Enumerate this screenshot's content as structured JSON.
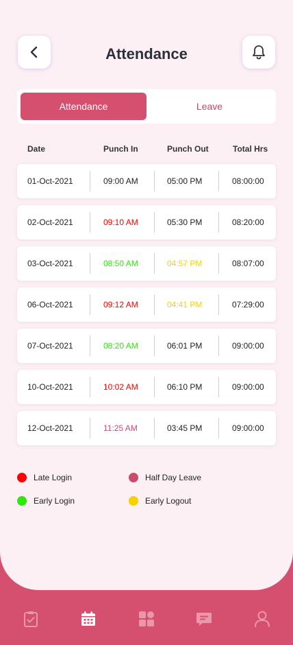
{
  "header": {
    "title": "Attendance"
  },
  "tabs": [
    {
      "label": "Attendance",
      "active": true
    },
    {
      "label": "Leave",
      "active": false
    }
  ],
  "table": {
    "columns": [
      "Date",
      "Punch In",
      "Punch Out",
      "Total Hrs"
    ],
    "rows": [
      {
        "date": "01-Oct-2021",
        "punch_in": "09:00 AM",
        "punch_in_status": "normal",
        "punch_out": "05:00 PM",
        "punch_out_status": "normal",
        "total": "08:00:00"
      },
      {
        "date": "02-Oct-2021",
        "punch_in": "09:10 AM",
        "punch_in_status": "late_login",
        "punch_out": "05:30 PM",
        "punch_out_status": "normal",
        "total": "08:20:00"
      },
      {
        "date": "03-Oct-2021",
        "punch_in": "08:50 AM",
        "punch_in_status": "early_login",
        "punch_out": "04:57 PM",
        "punch_out_status": "early_logout",
        "total": "08:07:00"
      },
      {
        "date": "06-Oct-2021",
        "punch_in": "09:12 AM",
        "punch_in_status": "late_login",
        "punch_out": "04:41 PM",
        "punch_out_status": "early_logout",
        "total": "07:29:00"
      },
      {
        "date": "07-Oct-2021",
        "punch_in": "08:20 AM",
        "punch_in_status": "early_login",
        "punch_out": "06:01 PM",
        "punch_out_status": "normal",
        "total": "09:00:00"
      },
      {
        "date": "10-Oct-2021",
        "punch_in": "10:02 AM",
        "punch_in_status": "late_login",
        "punch_out": "06:10 PM",
        "punch_out_status": "normal",
        "total": "09:00:00"
      },
      {
        "date": "12-Oct-2021",
        "punch_in": "11:25 AM",
        "punch_in_status": "half_day_leave",
        "punch_out": "03:45 PM",
        "punch_out_status": "normal",
        "total": "09:00:00"
      }
    ]
  },
  "legend": [
    {
      "key": "late_login",
      "label": "Late Login",
      "color": "#ff0000"
    },
    {
      "key": "half_day_leave",
      "label": "Half Day Leave",
      "color": "#cc4c6c"
    },
    {
      "key": "early_login",
      "label": "Early Login",
      "color": "#2ee80c"
    },
    {
      "key": "early_logout",
      "label": "Early Logout",
      "color": "#f5d200"
    }
  ],
  "status_colors": {
    "normal": "#222222",
    "late_login": "#ff0000",
    "early_login": "#2ee80c",
    "early_logout": "#f5d200",
    "half_day_leave": "#cc4c6c"
  },
  "nav": [
    {
      "icon": "clipboard-check-icon",
      "active": false
    },
    {
      "icon": "calendar-icon",
      "active": true
    },
    {
      "icon": "dashboard-grid-icon",
      "active": false
    },
    {
      "icon": "chat-icon",
      "active": false
    },
    {
      "icon": "user-icon",
      "active": false
    }
  ],
  "colors": {
    "primary": "#d4506e",
    "background": "#fcf0f4",
    "nav_icon_inactive": "#ea96ab",
    "nav_icon_active": "#ffffff"
  }
}
